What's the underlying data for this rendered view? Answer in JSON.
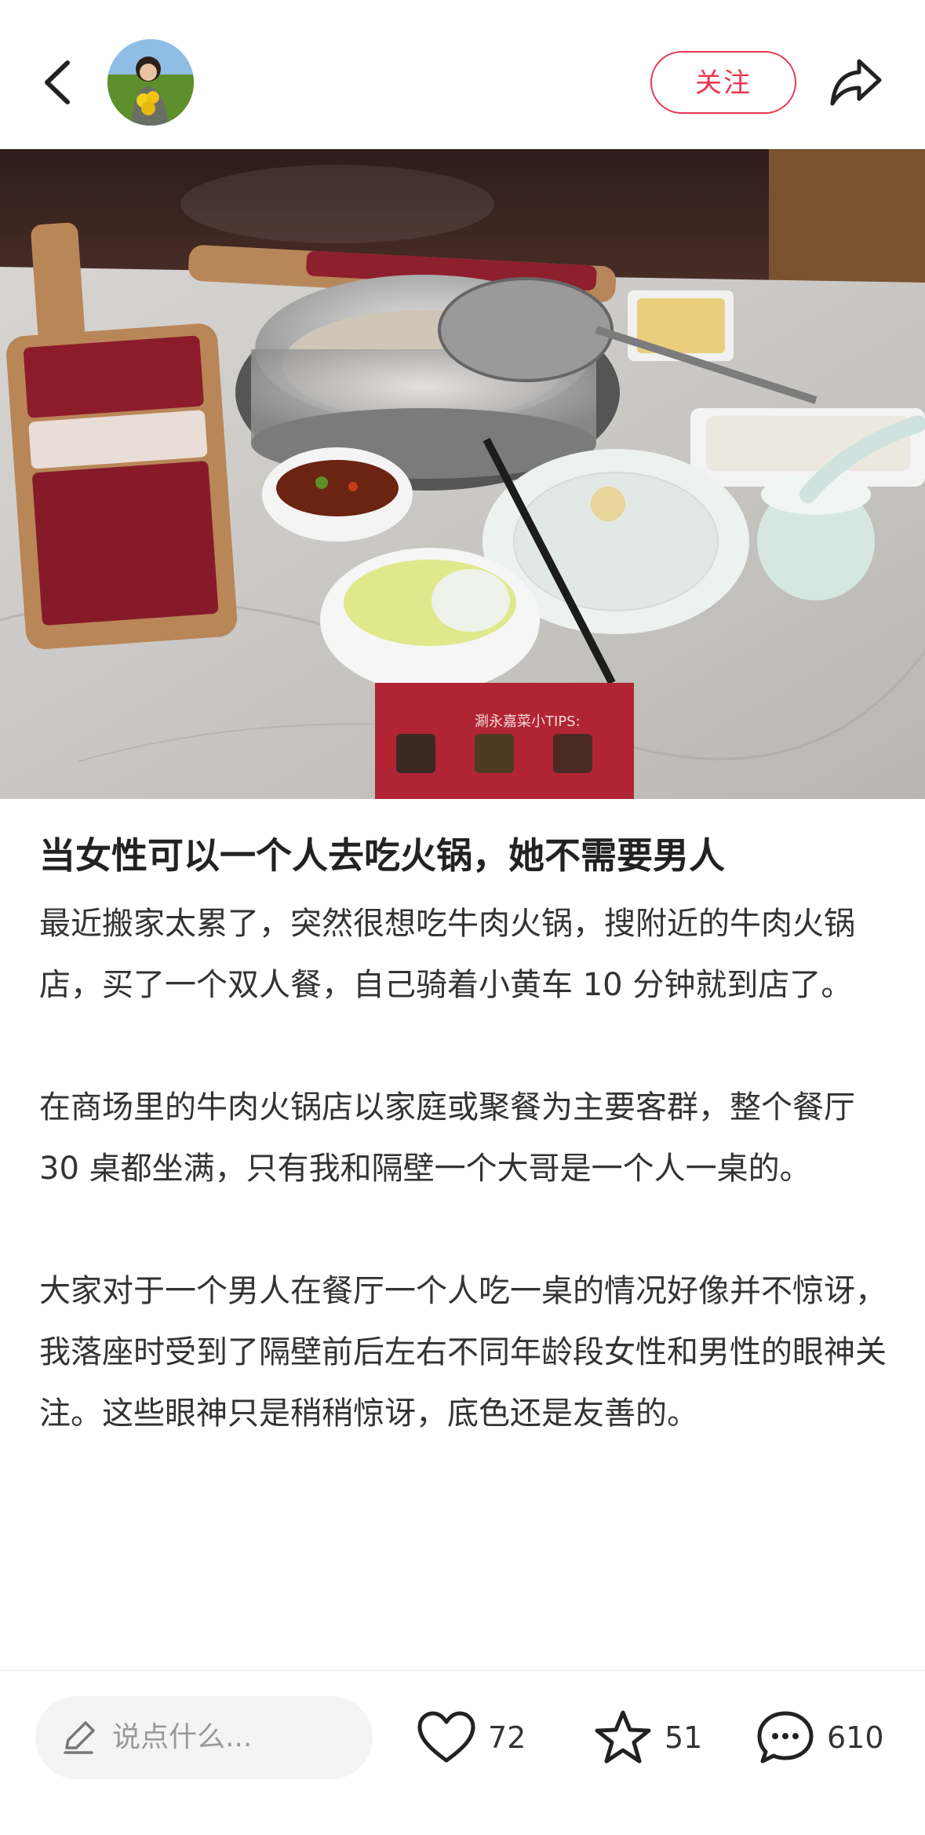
{
  "header": {
    "follow_label": "关注",
    "icons": {
      "back": "chevron-left-icon",
      "share": "share-arrow-icon"
    }
  },
  "post": {
    "title": "当女性可以一个人去吃火锅，她不需要男人",
    "paragraphs": [
      "最近搬家太累了，突然很想吃牛肉火锅，搜附近的牛肉火锅店，买了一个双人餐，自己骑着小黄车 10 分钟就到店了。",
      "在商场里的牛肉火锅店以家庭或聚餐为主要客群，整个餐厅 30 桌都坐满，只有我和隔壁一个大哥是一个人一桌的。",
      "大家对于一个男人在餐厅一个人吃一桌的情况好像并不惊讶，我落座时受到了隔壁前后左右不同年龄段女性和男性的眼神关注。这些眼神只是稍稍惊讶，底色还是友善的。"
    ],
    "photo_tip_text": "涮永嘉菜小TIPS:"
  },
  "bottom": {
    "comment_placeholder": "说点什么...",
    "likes": "72",
    "stars": "51",
    "comments": "610"
  },
  "colors": {
    "accent": "#e8384f",
    "text": "#222222",
    "placeholder": "#999999"
  }
}
